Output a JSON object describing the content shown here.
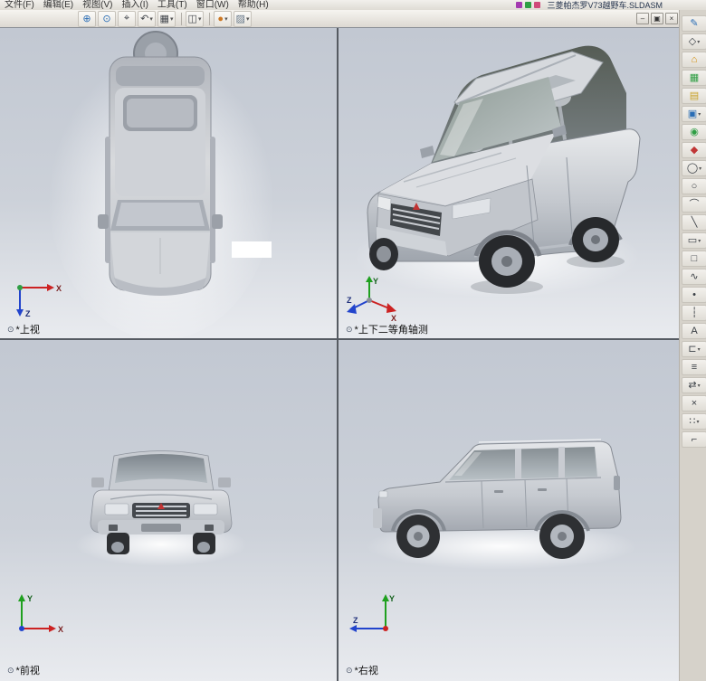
{
  "menubar": {
    "items": [
      "文件(F)",
      "编辑(E)",
      "视图(V)",
      "插入(I)",
      "工具(T)",
      "窗口(W)",
      "帮助(H)"
    ],
    "doc_title": "三菱帕杰罗V73越野车.SLDASM"
  },
  "toolbar": {
    "icons": [
      {
        "name": "zoom-in-icon",
        "glyph": "⊕",
        "color": "#2a6db5"
      },
      {
        "name": "zoom-fit-icon",
        "glyph": "⊙",
        "color": "#2a6db5"
      },
      {
        "name": "zoom-area-icon",
        "glyph": "⌖",
        "color": "#44484e"
      },
      {
        "name": "previous-view-icon",
        "glyph": "↶",
        "color": "#44484e",
        "dropdown": true
      },
      {
        "name": "viewport-layout-icon",
        "glyph": "▦",
        "color": "#44484e",
        "dropdown": true
      },
      {
        "separator": true
      },
      {
        "name": "display-style-icon",
        "glyph": "◫",
        "color": "#44484e",
        "dropdown": true
      },
      {
        "separator": true
      },
      {
        "name": "appearance-icon",
        "glyph": "●",
        "color": "#cc7722",
        "dropdown": true
      },
      {
        "name": "scene-icon",
        "glyph": "▨",
        "color": "#667788",
        "dropdown": true
      }
    ],
    "window_controls": [
      {
        "name": "minimize-button",
        "glyph": "–"
      },
      {
        "name": "restore-button",
        "glyph": "▣"
      },
      {
        "name": "close-button",
        "glyph": "×"
      }
    ]
  },
  "sidebar": {
    "icons": [
      {
        "name": "sketch-icon",
        "glyph": "✎",
        "color": "#2a6db5"
      },
      {
        "name": "smart-dimension-icon",
        "glyph": "◇",
        "color": "#3a3f45",
        "dropdown": true
      },
      {
        "name": "standard-views-icon",
        "glyph": "⌂",
        "color": "#d08a00"
      },
      {
        "name": "grid-system-icon",
        "glyph": "▦",
        "color": "#2f9e44"
      },
      {
        "name": "open-folder-icon",
        "glyph": "▤",
        "color": "#c9a227"
      },
      {
        "name": "viewport-icon",
        "glyph": "▣",
        "color": "#2a6db5",
        "dropdown": true
      },
      {
        "name": "globe-icon",
        "glyph": "◉",
        "color": "#2f9e44"
      },
      {
        "name": "markup-icon",
        "glyph": "◆",
        "color": "#c03636"
      },
      {
        "name": "ellipse-icon",
        "glyph": "◯",
        "color": "#3a3f45",
        "dropdown": true
      },
      {
        "name": "circle-icon",
        "glyph": "○",
        "color": "#3a3f45"
      },
      {
        "name": "arc-icon",
        "glyph": "⌒",
        "color": "#3a3f45"
      },
      {
        "name": "line-icon",
        "glyph": "╲",
        "color": "#3a3f45"
      },
      {
        "name": "rectangle-icon",
        "glyph": "▭",
        "color": "#3a3f45",
        "dropdown": true
      },
      {
        "name": "polygon-icon",
        "glyph": "□",
        "color": "#3a3f45"
      },
      {
        "name": "spline-icon",
        "glyph": "∿",
        "color": "#3a3f45"
      },
      {
        "name": "point-icon",
        "glyph": "•",
        "color": "#3a3f45"
      },
      {
        "name": "centerline-icon",
        "glyph": "┆",
        "color": "#3a3f45"
      },
      {
        "name": "text-icon",
        "glyph": "A",
        "color": "#3a3f45"
      },
      {
        "name": "convert-entities-icon",
        "glyph": "⊏",
        "color": "#3a3f45",
        "dropdown": true
      },
      {
        "name": "offset-entities-icon",
        "glyph": "≡",
        "color": "#3a3f45"
      },
      {
        "name": "mirror-entities-icon",
        "glyph": "⇄",
        "color": "#3a3f45",
        "dropdown": true
      },
      {
        "name": "trim-entities-icon",
        "glyph": "×",
        "color": "#3a3f45"
      },
      {
        "name": "linear-pattern-icon",
        "glyph": "∷",
        "color": "#3a3f45",
        "dropdown": true
      },
      {
        "name": "fillet-icon",
        "glyph": "⌐",
        "color": "#3a3f45"
      }
    ]
  },
  "icons": {
    "view_label_glyph": "⊙",
    "dropdown_glyph": "▾"
  },
  "viewports": {
    "top": {
      "label": "*上视",
      "axes": [
        "X",
        "Z"
      ]
    },
    "iso": {
      "label": "*上下二等角轴测",
      "axes": [
        "Y",
        "X",
        "Z"
      ]
    },
    "front": {
      "label": "*前视",
      "axes": [
        "Y",
        "X"
      ]
    },
    "right": {
      "label": "*右视",
      "axes": [
        "Y",
        "Z"
      ]
    }
  },
  "colors": {
    "axis_x": "#cc2222",
    "axis_y": "#1fa01f",
    "axis_z": "#2244cc",
    "viewport_bg_top": "#c2c8d2",
    "viewport_bg_bottom": "#e9ebef",
    "chrome": "#d6d2ca"
  }
}
